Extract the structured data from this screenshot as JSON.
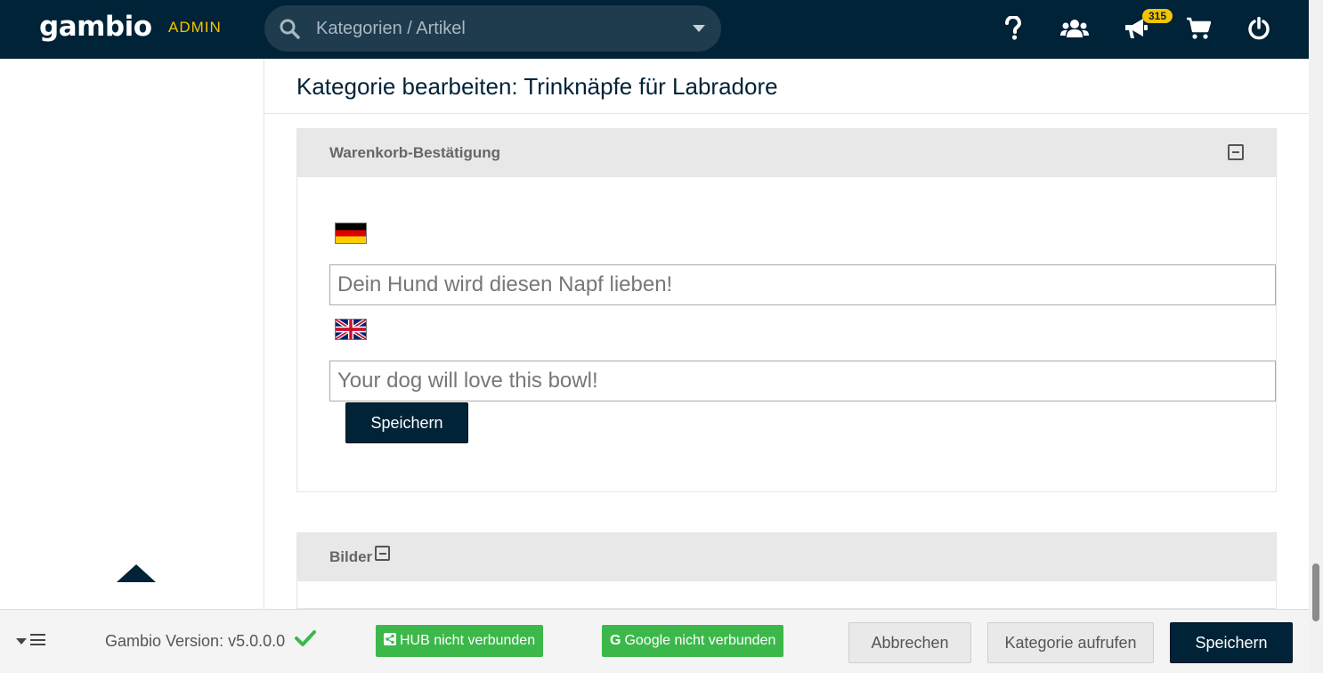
{
  "header": {
    "logo": "gambio",
    "admin_label": "ADMIN",
    "search_placeholder": "Kategorien / Artikel",
    "notification_count": "315",
    "icons": [
      "help-icon",
      "customers-icon",
      "announcements-icon",
      "cart-icon",
      "power-icon"
    ]
  },
  "page": {
    "title": "Kategorie bearbeiten: Trinknäpfe für Labradore"
  },
  "cart_confirmation_panel": {
    "title": "Warenkorb-Bestätigung",
    "fields": [
      {
        "language": "de",
        "flag": "german-flag-icon",
        "value": "Dein Hund wird diesen Napf lieben!"
      },
      {
        "language": "en",
        "flag": "uk-flag-icon",
        "value": "Your dog will love this bowl!"
      }
    ],
    "save_label": "Speichern"
  },
  "images_panel": {
    "title": "Bilder"
  },
  "footer": {
    "version": "Gambio Version: v5.0.0.0",
    "hub_status": "HUB nicht verbunden",
    "google_status": "Google nicht verbunden",
    "cancel_label": "Abbrechen",
    "open_category_label": "Kategorie aufrufen",
    "save_label": "Speichern"
  },
  "colors": {
    "topbar": "#002337",
    "accent": "#f5c400",
    "success": "#3cb84a"
  }
}
